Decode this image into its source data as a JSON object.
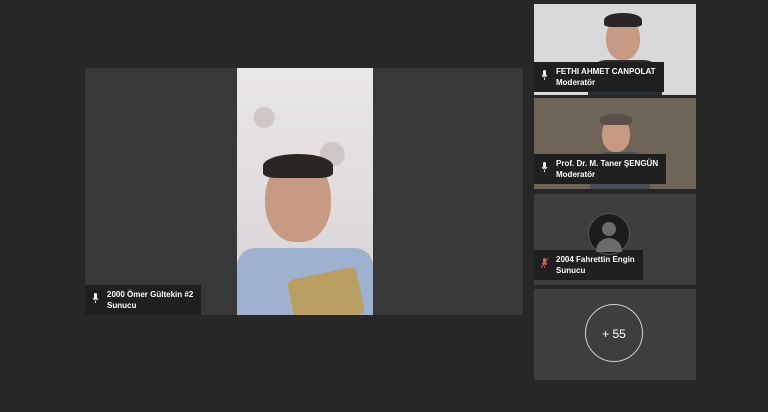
{
  "main_speaker": {
    "name": "2000 Ömer Gültekin #2",
    "role": "Sunucu"
  },
  "participants": [
    {
      "name": "FETHI AHMET CANPOLAT",
      "role": "Moderatör",
      "mic": "on"
    },
    {
      "name": "Prof. Dr. M. Taner ŞENGÜN",
      "role": "Moderatör",
      "mic": "on"
    },
    {
      "name": "2004 Fahrettin Engin",
      "role": "Sunucu",
      "mic": "muted"
    }
  ],
  "more_participants": "+ 55",
  "icons": {
    "mic": "microphone-icon",
    "muted": "microphone-muted-icon",
    "avatar": "user-avatar-icon"
  },
  "colors": {
    "background": "#272727",
    "label": "#1f1f1f",
    "muted": "#e05a4f"
  }
}
